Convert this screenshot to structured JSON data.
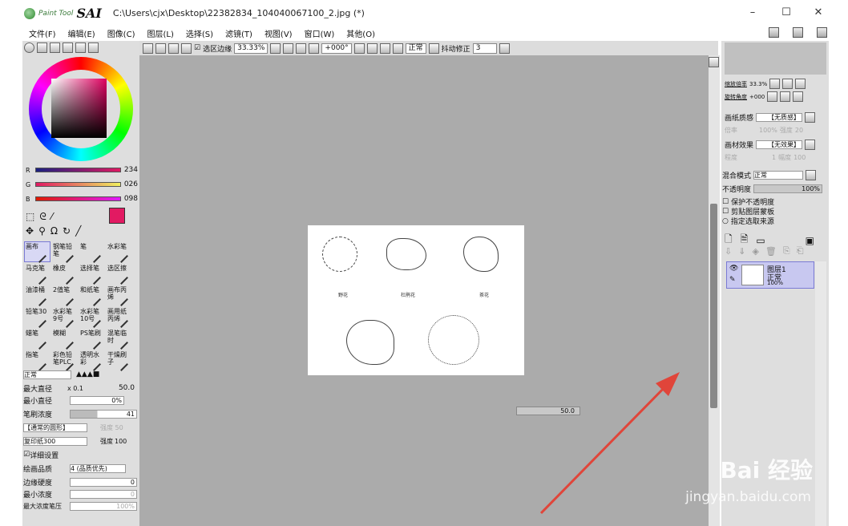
{
  "app": {
    "logo_small": "Paint Tool",
    "logo_big": "SAI",
    "title": "C:\\Users\\cjx\\Desktop\\22382834_104040067100_2.jpg (*)"
  },
  "window": {
    "minimize": "–",
    "maximize": "☐",
    "close": "✕"
  },
  "menu": [
    "文件(F)",
    "编辑(E)",
    "图像(C)",
    "图层(L)",
    "选择(S)",
    "滤镜(T)",
    "视图(V)",
    "窗口(W)",
    "其他(O)"
  ],
  "toolbar": {
    "selection_edge_label": "选区边缘",
    "zoom": "33.33%",
    "rotation": "+000°",
    "blend": "正常",
    "stabilizer_label": "抖动修正",
    "stabilizer_value": "3"
  },
  "color": {
    "r_label": "R",
    "g_label": "G",
    "b_label": "B",
    "r": "234",
    "g": "026",
    "b": "098",
    "primary_color": "#e21a62"
  },
  "tools": [
    {
      "name": "画布",
      "selected": true
    },
    {
      "name": "钢笔铅笔",
      "selected": false
    },
    {
      "name": "笔",
      "selected": false
    },
    {
      "name": "水彩笔",
      "selected": false
    },
    {
      "name": "马克笔",
      "selected": false
    },
    {
      "name": "橡皮",
      "selected": false
    },
    {
      "name": "选择笔",
      "selected": false
    },
    {
      "name": "选区擦",
      "selected": false
    },
    {
      "name": "油漆桶",
      "selected": false
    },
    {
      "name": "2值笔",
      "selected": false
    },
    {
      "name": "和纸笔",
      "selected": false
    },
    {
      "name": "画布丙烯",
      "selected": false
    },
    {
      "name": "铅笔30",
      "selected": false
    },
    {
      "name": "水彩笔9号",
      "selected": false
    },
    {
      "name": "水彩笔10号",
      "selected": false
    },
    {
      "name": "画用纸丙烯",
      "selected": false
    },
    {
      "name": "蜡笔",
      "selected": false
    },
    {
      "name": "模糊",
      "selected": false
    },
    {
      "name": "PS笔刷",
      "selected": false
    },
    {
      "name": "混笔临时",
      "selected": false
    },
    {
      "name": "指笔",
      "selected": false
    },
    {
      "name": "彩色铅笔PLC",
      "selected": false
    },
    {
      "name": "透明水彩",
      "selected": false
    },
    {
      "name": "干燥刷子",
      "selected": false
    }
  ],
  "brush": {
    "mode": "正常",
    "max_size_label": "最大直径",
    "max_size_mult": "x 0.1",
    "max_size": "50.0",
    "min_size_label": "最小直径",
    "min_size": "0%",
    "density_label": "笔刷浓度",
    "density": "41",
    "shape": "【通常的圆形】",
    "shape_strength": "强度 50",
    "texture": "复印纸300",
    "texture_strength_label": "强度",
    "texture_strength": "100",
    "detail_label": "详细设置",
    "quality_label": "绘画品质",
    "quality": "4 (品质优先)",
    "edge_label": "边缘硬度",
    "edge": "0",
    "min_density_label": "最小浓度",
    "min_density": "0",
    "max_pressure_label": "最大浓度笔压",
    "max_pressure": "100%"
  },
  "document": {
    "labels": [
      "野花",
      "杜鹃花",
      "茶花"
    ]
  },
  "status": {
    "size_indicator": "50.0"
  },
  "navigator": {
    "zoom_label": "缩放倍率",
    "zoom": "33.3%",
    "rotate_label": "旋转角度",
    "rotate": "+000"
  },
  "layer": {
    "paper_texture_label": "画纸质感",
    "paper_texture": "【无质感】",
    "magnify_label": "倍率",
    "magnify": "100%",
    "strength_label": "强度",
    "strength": "20",
    "effect_label": "画材效果",
    "effect": "【无效果】",
    "degree_label": "程度",
    "degree": "1",
    "width_label": "幅度",
    "width": "100",
    "blend_label": "混合模式",
    "blend": "正常",
    "opacity_label": "不透明度",
    "opacity": "100%",
    "protect_alpha": "保护不透明度",
    "clip_mask": "剪贴图层蒙板",
    "selection_source": "指定选取来源",
    "layer_name": "图层1",
    "layer_mode": "正常",
    "layer_opacity": "100%"
  },
  "watermark": {
    "line1": "Bai 经验",
    "line2": "jingyan.baidu.com"
  }
}
